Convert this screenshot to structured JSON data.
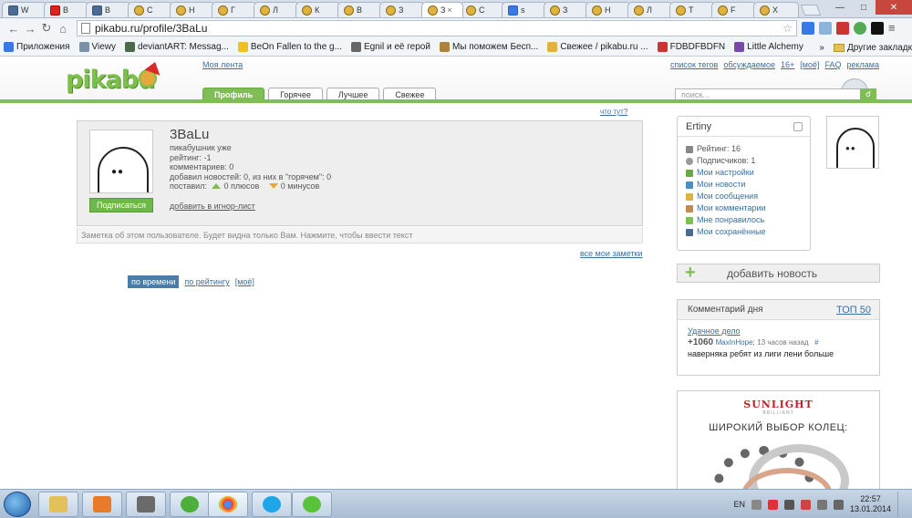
{
  "browser": {
    "tabs": [
      {
        "title": "W",
        "favicon": "vk-icon"
      },
      {
        "title": "В",
        "favicon": "youtube-icon"
      },
      {
        "title": "В",
        "favicon": "vk-icon"
      },
      {
        "title": "С",
        "favicon": "pikabu-icon"
      },
      {
        "title": "Н",
        "favicon": "pikabu-icon"
      },
      {
        "title": "Г",
        "favicon": "pikabu-icon"
      },
      {
        "title": "Л",
        "favicon": "pikabu-icon"
      },
      {
        "title": "К",
        "favicon": "pikabu-icon"
      },
      {
        "title": "В",
        "favicon": "pikabu-icon"
      },
      {
        "title": "З",
        "favicon": "pikabu-icon"
      },
      {
        "title": "З",
        "favicon": "pikabu-icon",
        "active": true
      },
      {
        "title": "С",
        "favicon": "pikabu-icon"
      },
      {
        "title": "s",
        "favicon": "google-icon"
      },
      {
        "title": "З",
        "favicon": "pikabu-icon"
      },
      {
        "title": "Н",
        "favicon": "pikabu-icon"
      },
      {
        "title": "Л",
        "favicon": "pikabu-icon"
      },
      {
        "title": "Т",
        "favicon": "pikabu-icon"
      },
      {
        "title": "F",
        "favicon": "pikabu-icon"
      },
      {
        "title": "Х",
        "favicon": "pikabu-icon"
      }
    ],
    "url": "pikabu.ru/profile/3BaLu",
    "bookmarks": [
      {
        "label": "Приложения",
        "icon": "apps-icon"
      },
      {
        "label": "Viewy",
        "icon": "viewy-icon"
      },
      {
        "label": "deviantART: Messag...",
        "icon": "deviantart-icon"
      },
      {
        "label": "BeOn Fallen to the g...",
        "icon": "smiley-icon"
      },
      {
        "label": "Egnil и её герой",
        "icon": "egnil-icon"
      },
      {
        "label": "Мы поможем Бесп...",
        "icon": "hand-icon"
      },
      {
        "label": "Свежее / pikabu.ru ...",
        "icon": "pikabu-icon"
      },
      {
        "label": "FDBDFBDFN",
        "icon": "image-icon"
      },
      {
        "label": "Little Alchemy",
        "icon": "flask-icon"
      }
    ],
    "bookmarks_more": "»",
    "other_bookmarks": "Другие закладк",
    "tab_close": "×"
  },
  "site": {
    "logo": "pikabu",
    "my_feed": "Моя лента",
    "top_links": [
      "список тегов",
      "обсуждаемое",
      "16+",
      "[моё]",
      "FAQ",
      "реклама"
    ],
    "nav_tabs": [
      "Профиль",
      "Горячее",
      "Лучшее",
      "Свежее"
    ],
    "search_placeholder": "поиск...",
    "whats_here": "что тут?"
  },
  "profile": {
    "username": "3BaLu",
    "subscribe_label": "Подписаться",
    "stats": {
      "title_line": "пикабушник уже",
      "rating": "рейтинг: -1",
      "comments": "комментариев: 0",
      "news": "добавил новостей: 0, из них в \"горячем\": 0",
      "placed_prefix": "поставил:",
      "plus": "0 плюсов",
      "minus": "0 минусов"
    },
    "ignore_label": "добавить в игнор-лист",
    "note_placeholder": "Заметка об этом пользователе. Будет видна только Вам. Нажмите, чтобы ввести текст",
    "all_notes": "все мои заметки",
    "sort": {
      "by_time": "по времени",
      "by_rating": "по рейтингу",
      "mine": "[моё]"
    }
  },
  "sidebar": {
    "user": {
      "name": "Ertiny",
      "rating": "Рейтинг: 16",
      "subscribers": "Подписчиков: 1",
      "menu": [
        {
          "label": "Мои настройки",
          "icon": "gear-icon",
          "color": "#6aa843"
        },
        {
          "label": "Мои новости",
          "icon": "news-icon",
          "color": "#4a8ec2"
        },
        {
          "label": "Мои сообщения",
          "icon": "envelope-icon",
          "color": "#e0b340"
        },
        {
          "label": "Мои комментарии",
          "icon": "comment-icon",
          "color": "#c08a50"
        },
        {
          "label": "Мне понравилось",
          "icon": "thumbs-up-icon",
          "color": "#7fbe55"
        },
        {
          "label": "Мои сохранённые",
          "icon": "save-icon",
          "color": "#4a6c94"
        }
      ]
    },
    "add_news": "добавить новость",
    "comment_of_day": {
      "title": "Комментарий дня",
      "top50": "ТОП 50",
      "post": "Удачное дело",
      "score": "+1060",
      "author": "MaxInHope;",
      "time": "13 часов назад",
      "hash": "#",
      "text": "наверняка ребят из лиги лени больше"
    },
    "ad": {
      "brand": "SUNLIGHT",
      "brand_sub": "BRILLIANT",
      "slogan": "ШИРОКИЙ ВЫБОР КОЛЕЦ:"
    }
  },
  "taskbar": {
    "language": "EN",
    "time": "22:57",
    "date": "13.01.2014"
  },
  "colors": {
    "pikabu_green": "#7fbe55",
    "link_blue": "#3a6fa0",
    "ad_red": "#c02026"
  }
}
